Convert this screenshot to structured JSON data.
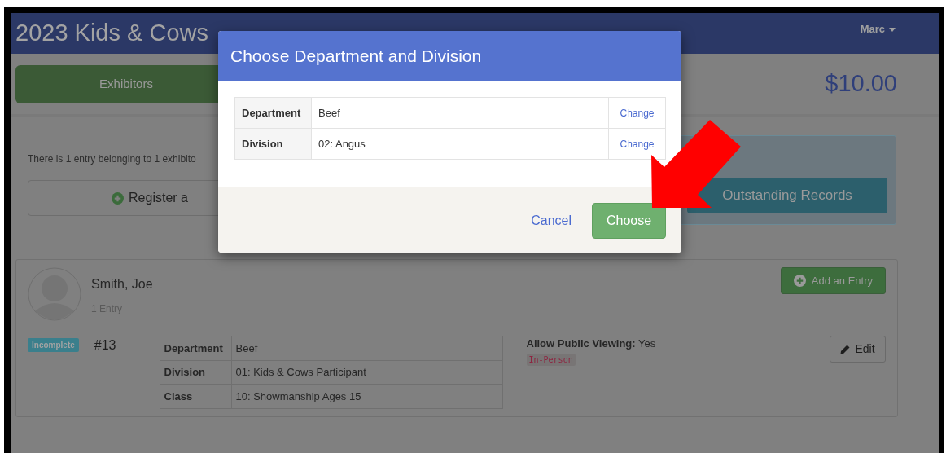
{
  "header": {
    "title": "2023 Kids & Cows",
    "user_menu": "Marc"
  },
  "tabs": [
    {
      "label": "Exhibitors",
      "selected": true
    }
  ],
  "total": "$10.00",
  "summary": "There is 1 entry belonging to 1 exhibito",
  "register_button": "Register a",
  "outstanding_button": "Outstanding Records",
  "exhibitor": {
    "name": "Smith, Joe",
    "entry_count": "1 Entry",
    "add_button": "Add an Entry",
    "entries": [
      {
        "status": "Incomplete",
        "number": "#13",
        "details": [
          {
            "label": "Department",
            "value": "Beef"
          },
          {
            "label": "Division",
            "value": "01: Kids & Cows Participant"
          },
          {
            "label": "Class",
            "value": "10: Showmanship Ages 15"
          }
        ],
        "public_viewing_label": "Allow Public Viewing:",
        "public_viewing_value": "Yes",
        "tag": "In-Person",
        "edit_button": "Edit"
      }
    ]
  },
  "modal": {
    "title": "Choose Department and Division",
    "rows": [
      {
        "label": "Department",
        "value": "Beef",
        "action": "Change"
      },
      {
        "label": "Division",
        "value": "02: Angus",
        "action": "Change"
      }
    ],
    "cancel": "Cancel",
    "choose": "Choose"
  }
}
